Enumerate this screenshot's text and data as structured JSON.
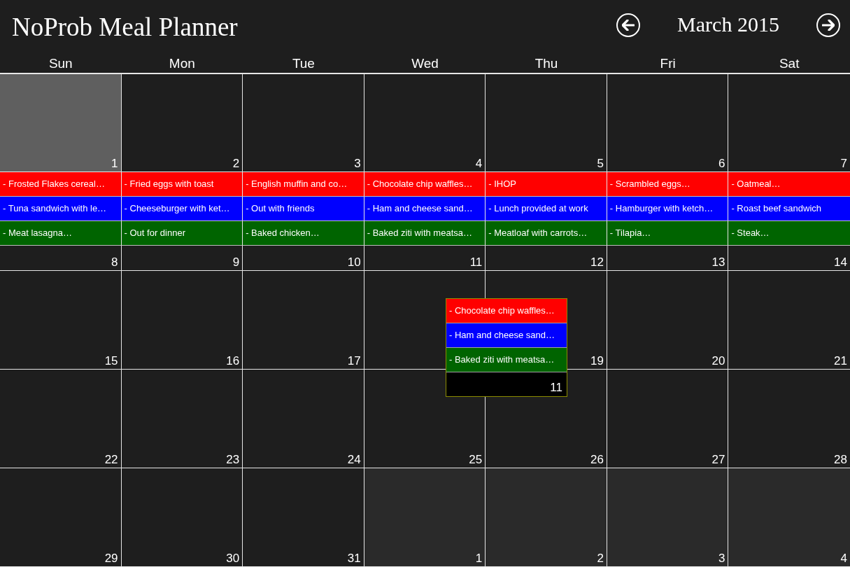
{
  "app": {
    "title": "NoProb Meal Planner"
  },
  "navigation": {
    "month": "March 2015"
  },
  "weekdays": [
    "Sun",
    "Mon",
    "Tue",
    "Wed",
    "Thu",
    "Fri",
    "Sat"
  ],
  "weeks": [
    {
      "kind": "expanded",
      "days": [
        {
          "number": "1",
          "selected": true,
          "outside_month": false,
          "meals": [
            {
              "text": "- Frosted Flakes cereal…",
              "color": "#ff0000"
            },
            {
              "text": "- Tuna sandwich with le…",
              "color": "#0000ff"
            },
            {
              "text": "- Meat lasagna…",
              "color": "#006400"
            }
          ]
        },
        {
          "number": "2",
          "selected": false,
          "outside_month": false,
          "meals": [
            {
              "text": "- Fried eggs with toast",
              "color": "#ff0000"
            },
            {
              "text": "- Cheeseburger with ket…",
              "color": "#0000ff"
            },
            {
              "text": "- Out for dinner",
              "color": "#006400"
            }
          ]
        },
        {
          "number": "3",
          "selected": false,
          "outside_month": false,
          "meals": [
            {
              "text": "- English muffin and co…",
              "color": "#ff0000"
            },
            {
              "text": "- Out with friends",
              "color": "#0000ff"
            },
            {
              "text": "- Baked chicken…",
              "color": "#006400"
            }
          ]
        },
        {
          "number": "4",
          "selected": false,
          "outside_month": false,
          "meals": [
            {
              "text": "- Chocolate chip waffles…",
              "color": "#ff0000"
            },
            {
              "text": "- Ham and cheese sand…",
              "color": "#0000ff"
            },
            {
              "text": "- Baked ziti with meatsa…",
              "color": "#006400"
            }
          ]
        },
        {
          "number": "5",
          "selected": false,
          "outside_month": false,
          "meals": [
            {
              "text": "- IHOP",
              "color": "#ff0000"
            },
            {
              "text": "- Lunch provided at work",
              "color": "#0000ff"
            },
            {
              "text": "- Meatloaf with carrots…",
              "color": "#006400"
            }
          ]
        },
        {
          "number": "6",
          "selected": false,
          "outside_month": false,
          "meals": [
            {
              "text": "- Scrambled eggs…",
              "color": "#ff0000"
            },
            {
              "text": "- Hamburger with ketch…",
              "color": "#0000ff"
            },
            {
              "text": "- Tilapia…",
              "color": "#006400"
            }
          ]
        },
        {
          "number": "7",
          "selected": false,
          "outside_month": false,
          "meals": [
            {
              "text": "- Oatmeal…",
              "color": "#ff0000"
            },
            {
              "text": "- Roast beef sandwich",
              "color": "#0000ff"
            },
            {
              "text": "- Steak…",
              "color": "#006400"
            }
          ]
        }
      ]
    },
    {
      "kind": "collapsed",
      "days": [
        {
          "number": "8",
          "selected": false,
          "outside_month": false
        },
        {
          "number": "9",
          "selected": false,
          "outside_month": false
        },
        {
          "number": "10",
          "selected": false,
          "outside_month": false
        },
        {
          "number": "11",
          "selected": false,
          "outside_month": false
        },
        {
          "number": "12",
          "selected": false,
          "outside_month": false
        },
        {
          "number": "13",
          "selected": false,
          "outside_month": false
        },
        {
          "number": "14",
          "selected": false,
          "outside_month": false
        }
      ]
    },
    {
      "kind": "normal",
      "days": [
        {
          "number": "15",
          "selected": false,
          "outside_month": false
        },
        {
          "number": "16",
          "selected": false,
          "outside_month": false
        },
        {
          "number": "17",
          "selected": false,
          "outside_month": false
        },
        {
          "selected": false,
          "outside_month": false
        },
        {
          "number": "19",
          "selected": false,
          "outside_month": false
        },
        {
          "number": "20",
          "selected": false,
          "outside_month": false
        },
        {
          "number": "21",
          "selected": false,
          "outside_month": false
        }
      ]
    },
    {
      "kind": "normal",
      "days": [
        {
          "number": "22",
          "selected": false,
          "outside_month": false
        },
        {
          "number": "23",
          "selected": false,
          "outside_month": false
        },
        {
          "number": "24",
          "selected": false,
          "outside_month": false
        },
        {
          "number": "25",
          "selected": false,
          "outside_month": false
        },
        {
          "number": "26",
          "selected": false,
          "outside_month": false
        },
        {
          "number": "27",
          "selected": false,
          "outside_month": false
        },
        {
          "number": "28",
          "selected": false,
          "outside_month": false
        }
      ]
    },
    {
      "kind": "normal",
      "days": [
        {
          "number": "29",
          "selected": false,
          "outside_month": false
        },
        {
          "number": "30",
          "selected": false,
          "outside_month": false
        },
        {
          "number": "31",
          "selected": false,
          "outside_month": false
        },
        {
          "number": "1",
          "selected": false,
          "outside_month": true
        },
        {
          "number": "2",
          "selected": false,
          "outside_month": true
        },
        {
          "number": "3",
          "selected": false,
          "outside_month": true
        },
        {
          "number": "4",
          "selected": false,
          "outside_month": true
        }
      ]
    }
  ],
  "popup": {
    "number": "11",
    "meals": [
      {
        "text": "- Chocolate chip waffles…",
        "color": "#ff0000"
      },
      {
        "text": "- Ham and cheese sand…",
        "color": "#0000ff"
      },
      {
        "text": "- Baked ziti with meatsa…",
        "color": "#006400"
      }
    ]
  }
}
